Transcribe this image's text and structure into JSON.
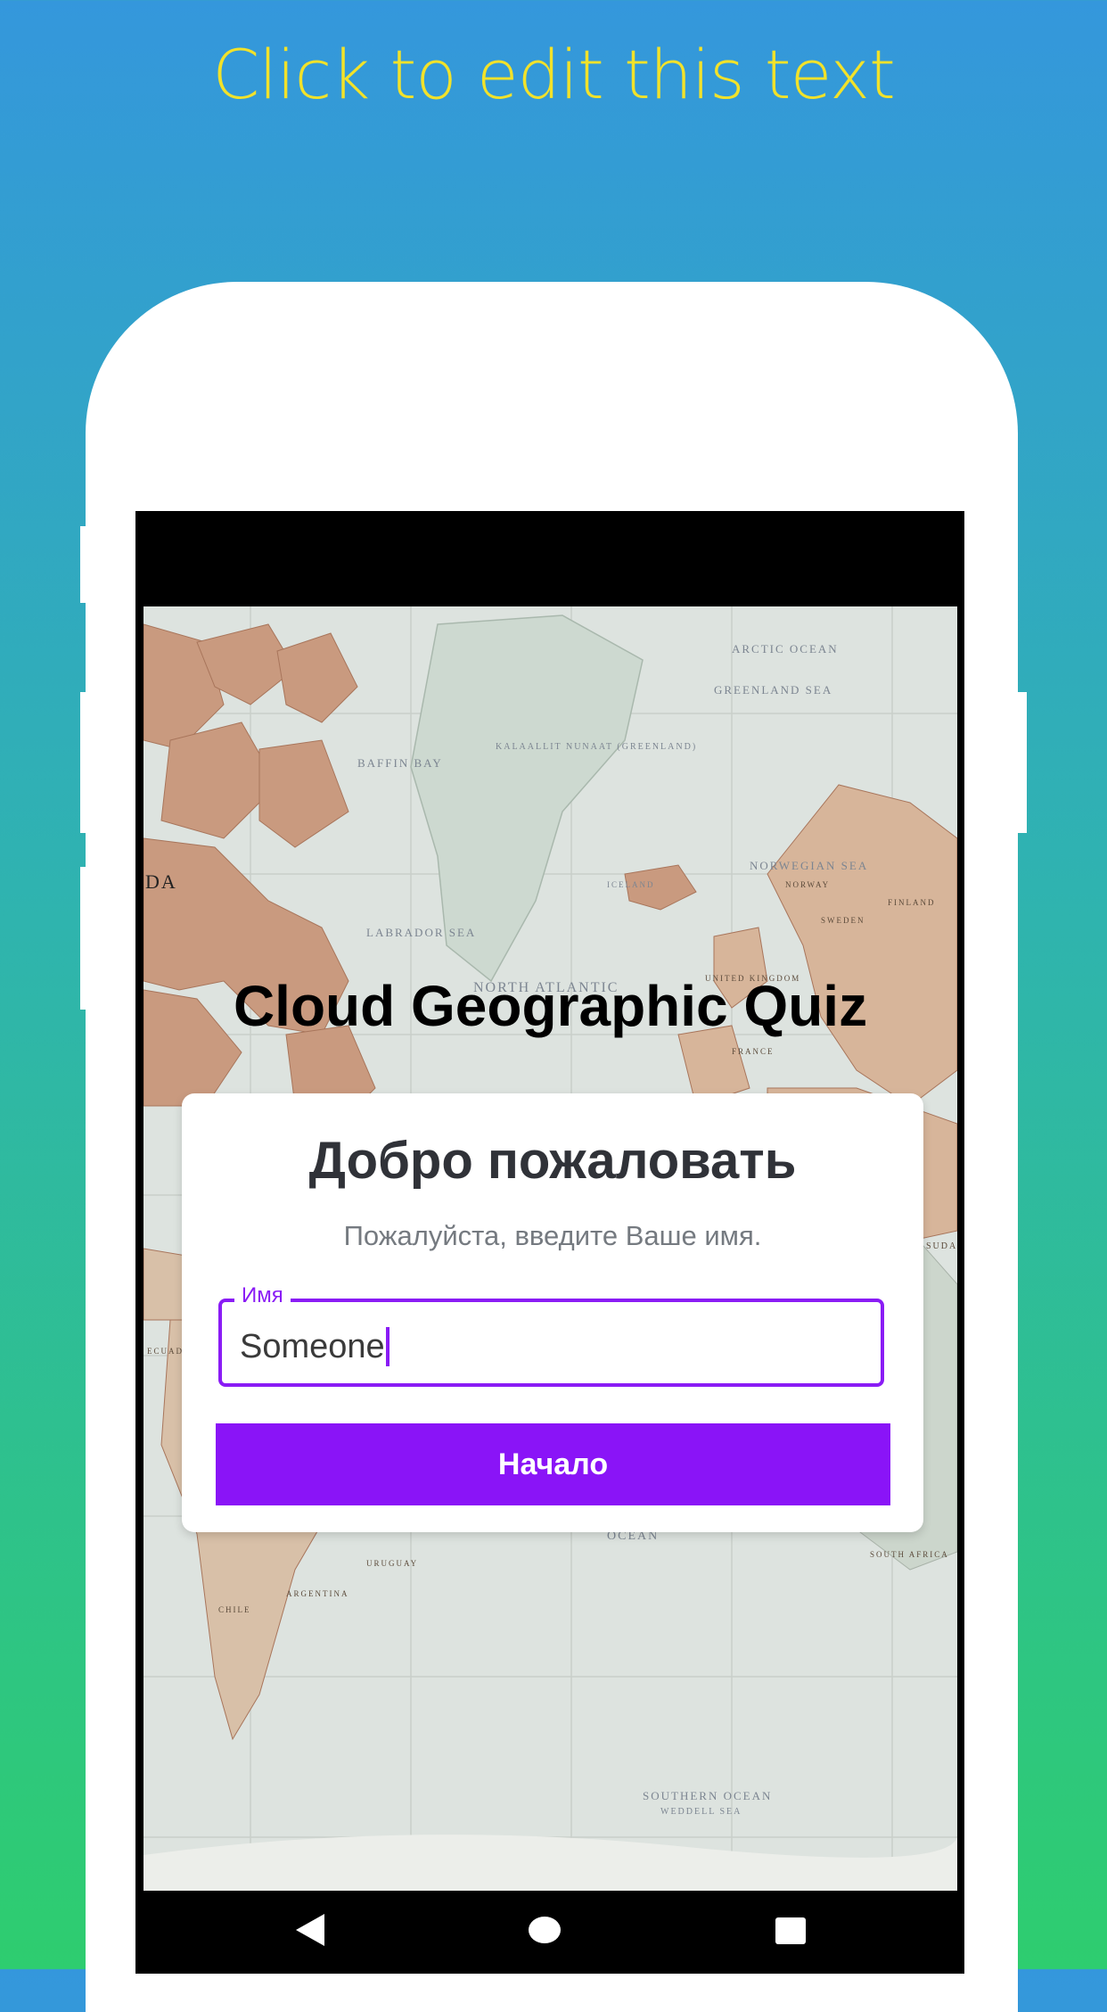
{
  "promo": {
    "text": "Click to edit this text"
  },
  "app": {
    "title": "Cloud Geographic Quiz",
    "card": {
      "heading": "Добро пожаловать",
      "subtitle": "Пожалуйста, введите Ваше имя.",
      "name_field": {
        "label": "Имя",
        "value": "Someone"
      },
      "start_button": "Начало"
    }
  },
  "map_labels": {
    "arctic": "ARCTIC OCEAN",
    "greenland_sea": "GREENLAND SEA",
    "baffin_bay": "BAFFIN BAY",
    "greenland": "KALAALLIT NUNAAT (GREENLAND)",
    "norwegian_sea": "NORWEGIAN SEA",
    "labrador_sea": "LABRADOR SEA",
    "north_atlantic": "NORTH ATLANTIC",
    "iceland": "ICELAND",
    "norway": "NORWAY",
    "sweden": "SWEDEN",
    "finland": "FINLAND",
    "united_kingdom": "UNITED KINGDOM",
    "france": "FRANCE",
    "ocean": "OCEAN",
    "south_africa": "SOUTH AFRICA",
    "chile": "CHILE",
    "argentina": "ARGENTINA",
    "uruguay": "URUGUAY",
    "ecuador": "ECUADOR",
    "southern_ocean": "SOUTHERN OCEAN",
    "weddell_sea": "WEDDELL SEA",
    "da": "DA",
    "suda": "SUDA"
  },
  "nav": {
    "back_icon": "back-triangle-icon",
    "home_icon": "home-circle-icon",
    "recent_icon": "recent-square-icon"
  },
  "colors": {
    "accent": "#8a14f7",
    "promo_text": "#f2e22a",
    "gradient_top": "#3497dc",
    "gradient_bottom": "#2ecd6f"
  }
}
